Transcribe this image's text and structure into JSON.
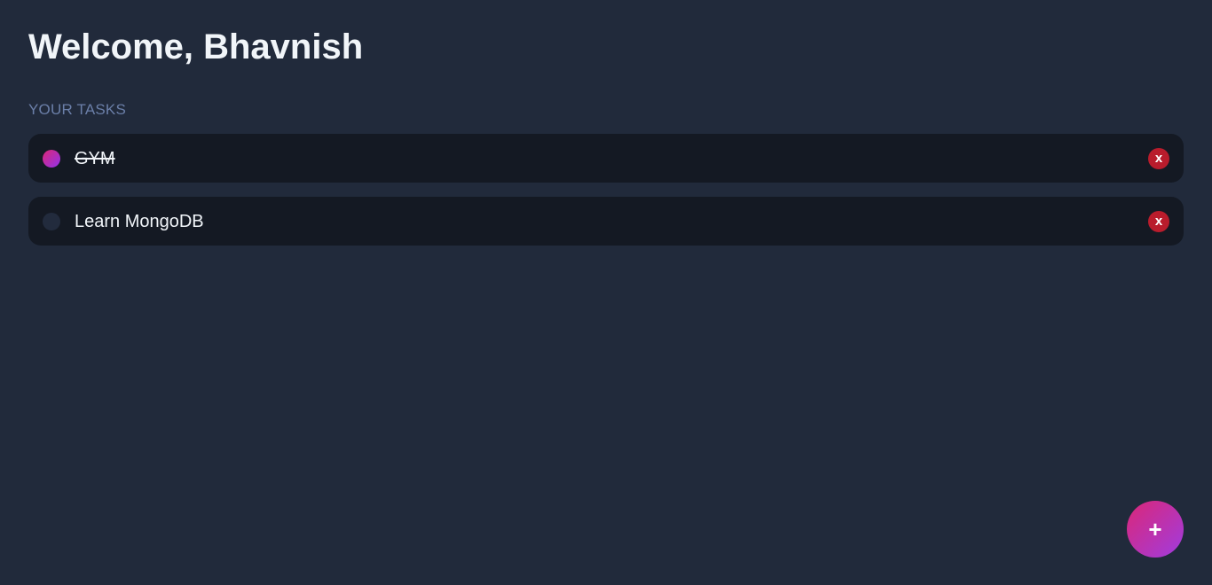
{
  "header": {
    "title": "Welcome, Bhavnish"
  },
  "tasks_section": {
    "label": "YOUR TASKS"
  },
  "tasks": [
    {
      "text": "GYM",
      "completed": true,
      "delete_label": "x"
    },
    {
      "text": "Learn MongoDB",
      "completed": false,
      "delete_label": "x"
    }
  ],
  "fab": {
    "label": "+",
    "icon": "plus-icon"
  },
  "colors": {
    "background": "#212a3b",
    "card": "#141923",
    "accent_gradient_start": "#db2777",
    "accent_gradient_end": "#9333ea",
    "delete": "#b91c2c",
    "section_label": "#6b7fa8"
  }
}
